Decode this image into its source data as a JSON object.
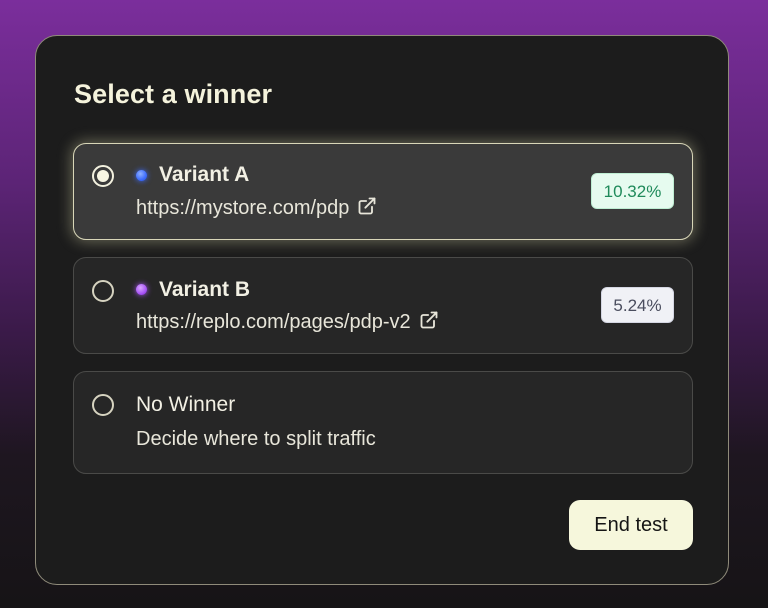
{
  "card": {
    "title": "Select a winner"
  },
  "options": [
    {
      "name": "Variant A",
      "url": "https://mystore.com/pdp",
      "rate": "10.32%",
      "selected": true,
      "dot_color": "#4a7bff",
      "icon": "external-link-icon"
    },
    {
      "name": "Variant B",
      "url": "https://replo.com/pages/pdp-v2",
      "rate": "5.24%",
      "selected": false,
      "dot_color": "#a855f7",
      "icon": "external-link-icon"
    },
    {
      "name": "No Winner",
      "description": "Decide where to split traffic",
      "selected": false
    }
  ],
  "actions": {
    "end_test_label": "End test"
  },
  "colors": {
    "badge_green_bg": "#e6fbef",
    "badge_green_text": "#1f8a5a",
    "badge_neutral_bg": "#f0f1f6",
    "badge_neutral_text": "#4a4d5e",
    "button_bg": "#f6f7dc",
    "background_top": "#7b2e9c"
  }
}
